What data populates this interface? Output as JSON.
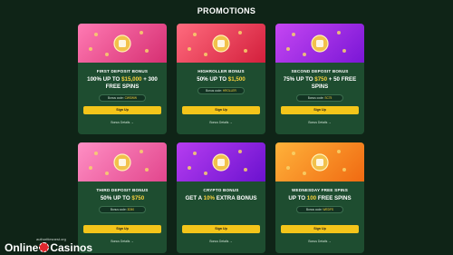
{
  "page": {
    "title": "PROMOTIONS"
  },
  "colors": {
    "background": "#0f2417",
    "card": "#1e4d30",
    "accent": "#f7d13e",
    "button": "#f4c51a"
  },
  "cards": [
    {
      "banner_colors": [
        "#ff7ab3",
        "#d62f72"
      ],
      "icon": "golden-slot-icon",
      "title": "FIRST DEPOSIT BONUS",
      "offer_pre": "100% UP TO ",
      "offer_hl": "$15,000",
      "offer_post": " + 300 FREE SPINS",
      "code_label": "Bonus code: ",
      "code": "CWSWW",
      "button": "Sign Up",
      "details": "Bonus Details →"
    },
    {
      "banner_colors": [
        "#ff6b7e",
        "#d31f3c"
      ],
      "icon": "golden-dice-icon",
      "title": "HIGHROLLER BONUS",
      "offer_pre": "50% UP TO ",
      "offer_hl": "$1,500",
      "offer_post": "",
      "code_label": "Bonus code: ",
      "code": "HROLLER",
      "button": "Sign Up",
      "details": "Bonus Details →"
    },
    {
      "banner_colors": [
        "#c546f2",
        "#7a17d6"
      ],
      "icon": "cards-icon",
      "title": "SECOND DEPOSIT BONUS",
      "offer_pre": "75% UP TO ",
      "offer_hl": "$750",
      "offer_post": " + 50 FREE SPINS",
      "code_label": "Bonus code: ",
      "code": "SC75",
      "button": "Sign Up",
      "details": "Bonus Details →"
    },
    {
      "banner_colors": [
        "#ff8fc4",
        "#e2468d"
      ],
      "icon": "golden-chips-icon",
      "title": "THIRD DEPOSIT BONUS",
      "offer_pre": "50% UP TO ",
      "offer_hl": "$750",
      "offer_post": "",
      "code_label": "Bonus code: ",
      "code": "3D50",
      "button": "Sign Up",
      "details": "Bonus Details →"
    },
    {
      "banner_colors": [
        "#b63df0",
        "#6b12cf"
      ],
      "icon": "crypto-coin-icon",
      "title": "CRYPTO BONUS",
      "offer_pre": "GET A ",
      "offer_hl": "10%",
      "offer_post": " EXTRA BONUS",
      "code_label": "",
      "code": "",
      "button": "Sign Up",
      "details": "Bonus Details →"
    },
    {
      "banner_colors": [
        "#ffb23a",
        "#f06a12"
      ],
      "icon": "free-spins-icon",
      "title": "WEDNESDAY FREE SPINS",
      "offer_pre": "UP TO ",
      "offer_hl": "100",
      "offer_post": " FREE SPINS",
      "code_label": "Bonus code: ",
      "code": "WEDFS",
      "button": "Sign Up",
      "details": "Bonus Details →"
    }
  ],
  "logo": {
    "small": "authoritiesnest.org",
    "main_a": "Online",
    "main_b": "Casinos"
  }
}
